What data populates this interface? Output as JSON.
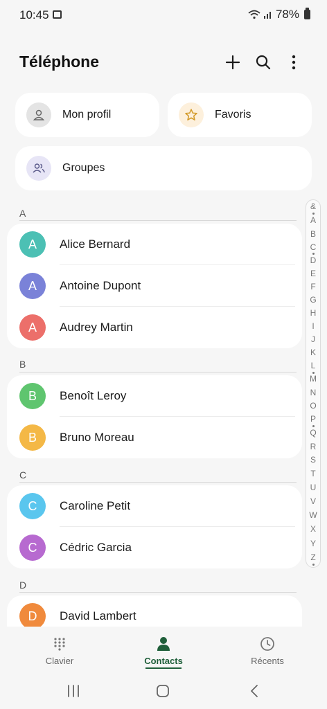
{
  "status_bar": {
    "time": "10:45",
    "battery": "78%"
  },
  "header": {
    "title": "Téléphone"
  },
  "quick_cards": {
    "profile": "Mon profil",
    "favorites": "Favoris",
    "groups": "Groupes"
  },
  "sections": [
    {
      "letter": "A",
      "contacts": [
        {
          "initial": "A",
          "name": "Alice Bernard",
          "color": "#4cc0b4"
        },
        {
          "initial": "A",
          "name": "Antoine Dupont",
          "color": "#7a82d8"
        },
        {
          "initial": "A",
          "name": "Audrey Martin",
          "color": "#ec6f6a"
        }
      ]
    },
    {
      "letter": "B",
      "contacts": [
        {
          "initial": "B",
          "name": "Benoît Leroy",
          "color": "#5fc56f"
        },
        {
          "initial": "B",
          "name": "Bruno Moreau",
          "color": "#f4b846"
        }
      ]
    },
    {
      "letter": "C",
      "contacts": [
        {
          "initial": "C",
          "name": "Caroline Petit",
          "color": "#5ac6ee"
        },
        {
          "initial": "C",
          "name": "Cédric Garcia",
          "color": "#b76ad0"
        }
      ]
    },
    {
      "letter": "D",
      "contacts": [
        {
          "initial": "D",
          "name": "David Lambert",
          "color": "#f08a3c"
        }
      ]
    }
  ],
  "index_letters": [
    "&",
    "A",
    "B",
    "C",
    "D",
    "E",
    "F",
    "G",
    "H",
    "I",
    "J",
    "K",
    "L",
    "M",
    "N",
    "O",
    "P",
    "Q",
    "R",
    "S",
    "T",
    "U",
    "V",
    "W",
    "X",
    "Y",
    "Z"
  ],
  "bottom_nav": {
    "keypad": "Clavier",
    "contacts": "Contacts",
    "recents": "Récents"
  },
  "colors": {
    "accent": "#1f5f3a",
    "background": "#f6f6f6",
    "card": "#ffffff"
  }
}
